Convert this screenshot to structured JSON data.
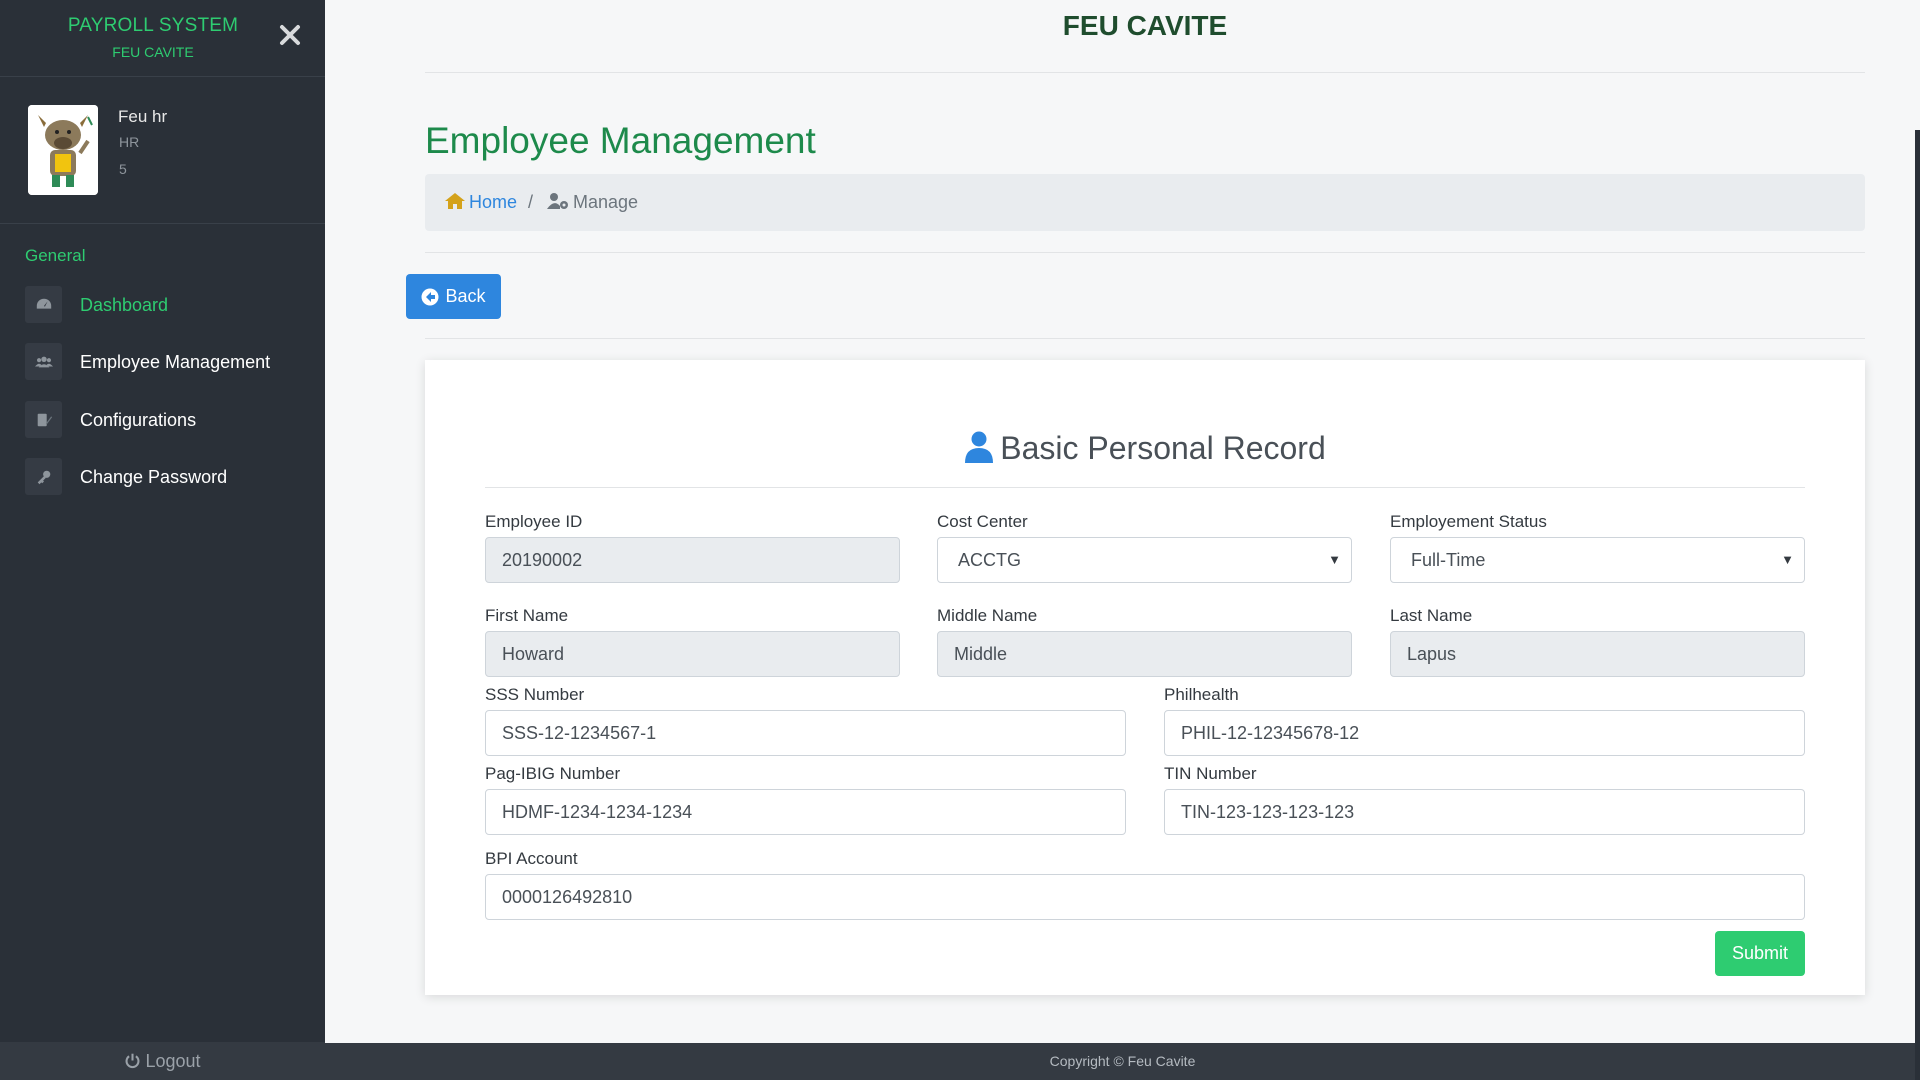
{
  "sidebar": {
    "brand_title": "PAYROLL SYSTEM",
    "brand_subtitle": "FEU CAVITE",
    "profile": {
      "name": "Feu hr",
      "role": "HR",
      "number": "5"
    },
    "section_title": "General",
    "items": [
      {
        "label": "Dashboard",
        "icon": "tachometer-icon",
        "active": true
      },
      {
        "label": "Employee Management",
        "icon": "users-icon",
        "active": false
      },
      {
        "label": "Configurations",
        "icon": "config-icon",
        "active": false
      },
      {
        "label": "Change Password",
        "icon": "key-icon",
        "active": false
      }
    ],
    "logout_label": "Logout"
  },
  "header": {
    "title": "FEU CAVITE"
  },
  "page": {
    "title": "Employee Management",
    "breadcrumb": {
      "home": "Home",
      "separator": "/",
      "current": "Manage"
    },
    "back_label": "Back"
  },
  "form": {
    "title": "Basic Personal Record",
    "employee_id": {
      "label": "Employee ID",
      "value": "20190002"
    },
    "cost_center": {
      "label": "Cost Center",
      "value": "ACCTG"
    },
    "employment_status": {
      "label": "Employement Status",
      "value": "Full-Time"
    },
    "first_name": {
      "label": "First Name",
      "value": "Howard"
    },
    "middle_name": {
      "label": "Middle Name",
      "value": "Middle"
    },
    "last_name": {
      "label": "Last Name",
      "value": "Lapus"
    },
    "sss": {
      "label": "SSS Number",
      "value": "SSS-12-1234567-1"
    },
    "philhealth": {
      "label": "Philhealth",
      "value": "PHIL-12-12345678-12"
    },
    "pagibig": {
      "label": "Pag-IBIG Number",
      "value": "HDMF-1234-1234-1234"
    },
    "tin": {
      "label": "TIN Number",
      "value": "TIN-123-123-123-123"
    },
    "bpi": {
      "label": "BPI Account",
      "value": "0000126492810"
    },
    "submit_label": "Submit"
  },
  "footer": {
    "text": "Copyright © Feu Cavite"
  },
  "colors": {
    "accent_green": "#2ecc71",
    "primary_blue": "#2e86de",
    "sidebar_bg": "#2a3038"
  }
}
